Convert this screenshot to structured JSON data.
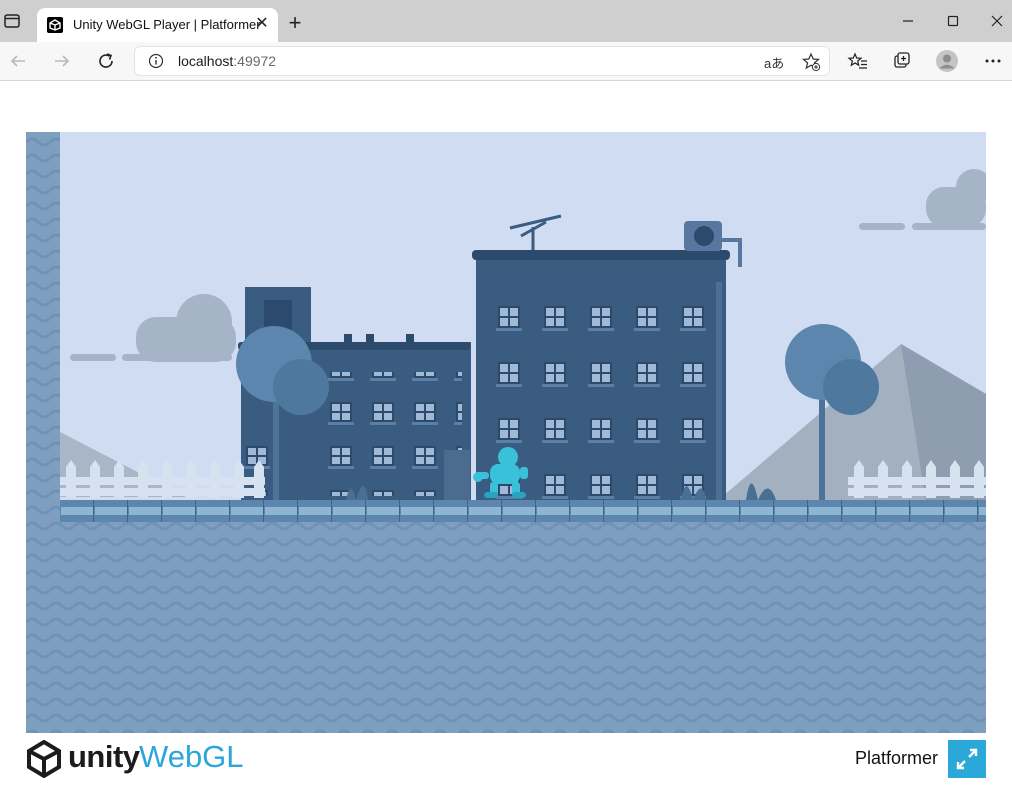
{
  "browser": {
    "tab_title": "Unity WebGL Player | Platformer",
    "url_host": "localhost",
    "url_port": ":49972",
    "read_aloud_label": "aあ"
  },
  "game": {
    "scene": "platformer-city-level",
    "colors": {
      "sky": "#cfdcf2",
      "building": "#3a5c80",
      "ground": "#7e9fbf",
      "player": "#38c1d9"
    }
  },
  "footer": {
    "logo_word": "unity",
    "logo_product": "WebGL",
    "build_title": "Platformer",
    "accent": "#2aa8d8"
  }
}
